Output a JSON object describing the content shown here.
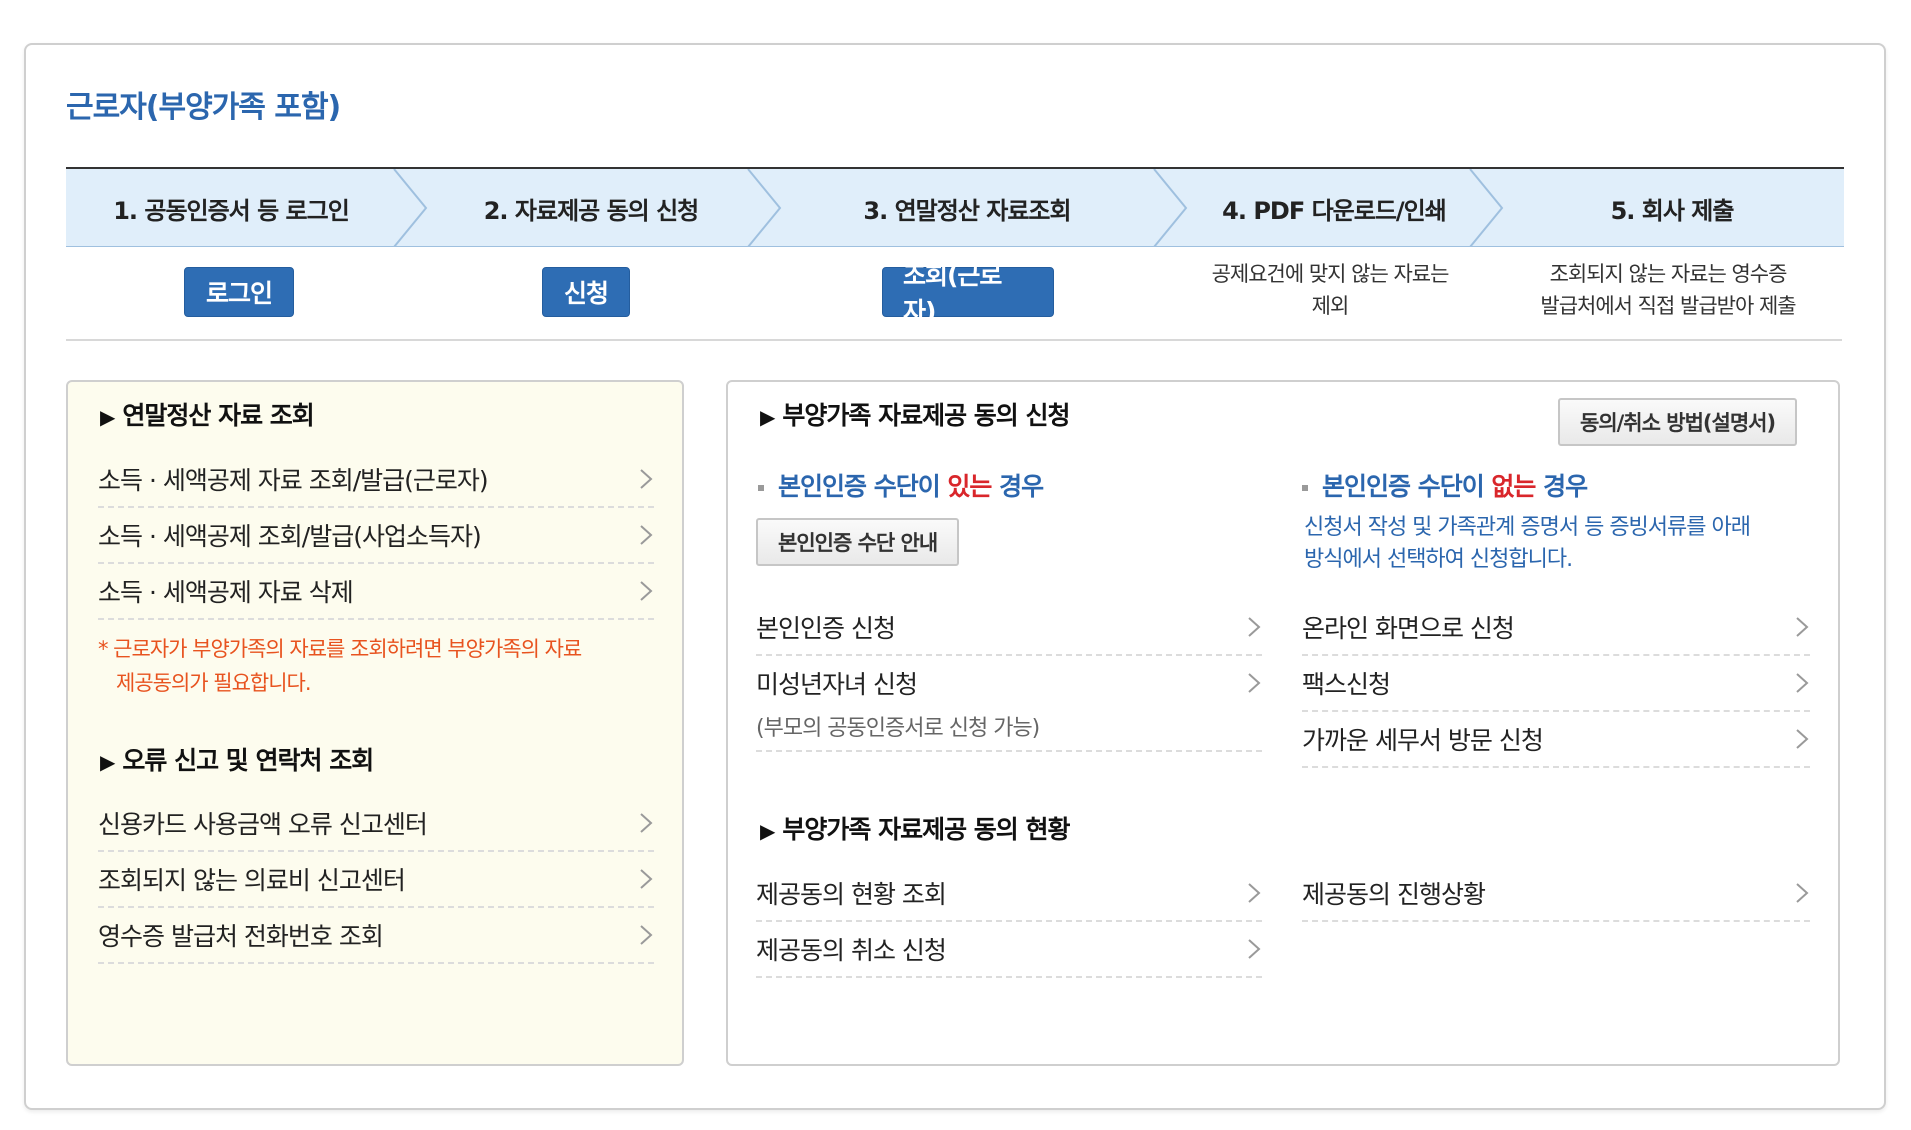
{
  "section_title": "근로자(부양가족 포함)",
  "steps": [
    {
      "label": "1. 공동인증서 등 로그인"
    },
    {
      "label": "2. 자료제공 동의 신청"
    },
    {
      "label": "3. 연말정산 자료조회"
    },
    {
      "label": "4. PDF 다운로드/인쇄"
    },
    {
      "label": "5. 회사 제출"
    }
  ],
  "step_actions": {
    "login": "로그인",
    "apply": "신청",
    "inquiry": "조회(근로자)",
    "note4_line1": "공제요건에 맞지 않는 자료는",
    "note4_line2": "제외",
    "note5_line1": "조회되지 않는 자료는 영수증",
    "note5_line2": "발급처에서 직접 발급받아 제출"
  },
  "left_panel": {
    "title1": "연말정산 자료 조회",
    "items1": [
      "소득 · 세액공제 자료 조회/발급(근로자)",
      "소득 · 세액공제 조회/발급(사업소득자)",
      "소득 · 세액공제 자료 삭제"
    ],
    "notice_line1": "*  근로자가 부양가족의 자료를 조회하려면 부양가족의 자료",
    "notice_line2": "제공동의가 필요합니다.",
    "title2": "오류 신고 및 연락처 조회",
    "items2": [
      "신용카드 사용금액 오류 신고센터",
      "조회되지 않는 의료비 신고센터",
      "영수증 발급처 전화번호 조회"
    ]
  },
  "right_panel": {
    "title1": "부양가족 자료제공 동의 신청",
    "howto_button": "동의/취소 방법(설명서)",
    "with_auth": {
      "prefix": "본인인증 수단이 ",
      "highlight": "있는",
      "suffix": " 경우"
    },
    "auth_guide_button": "본인인증 수단 안내",
    "with_items": [
      {
        "label": "본인인증 신청"
      },
      {
        "label": "미성년자녀 신청",
        "sub": "(부모의 공동인증서로 신청 가능)"
      }
    ],
    "without_auth": {
      "prefix": "본인인증 수단이 ",
      "highlight": "없는",
      "suffix": " 경우"
    },
    "without_note_line1": "신청서 작성 및 가족관계 증명서 등 증빙서류를 아래",
    "without_note_line2": "방식에서 선택하여 신청합니다.",
    "without_items": [
      "온라인 화면으로 신청",
      "팩스신청",
      "가까운 세무서 방문 신청"
    ],
    "title2": "부양가족 자료제공 동의 현황",
    "status_left": [
      "제공동의 현황 조회",
      "제공동의 취소 신청"
    ],
    "status_right": [
      "제공동의 진행상황"
    ]
  },
  "colors": {
    "accent": "#2b66ae",
    "button": "#2e6db4",
    "warning": "#e8531f",
    "highlight": "#d9262b",
    "step_bg": "#e0eefa",
    "left_bg": "#fdfcee"
  },
  "icons": {
    "chevron": "chevron-right-icon",
    "triangle": "triangle-right-icon"
  }
}
